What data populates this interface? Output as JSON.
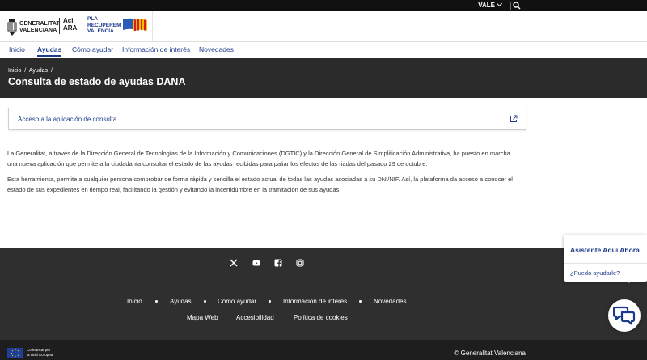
{
  "topbar": {
    "language": "VALE",
    "icons": [
      "chevron-down-icon",
      "search-icon"
    ]
  },
  "header": {
    "gva_line1": "GENERALITAT",
    "gva_line2": "VALENCIANA",
    "aci_line1": "Aci.",
    "aci_line2": "ARA.",
    "pla_line1": "PLA",
    "pla_line2": "RECUPEREM",
    "pla_line3": "VALÈNCIA"
  },
  "nav": {
    "items": [
      "Inicio",
      "Ayudas",
      "Cómo ayudar",
      "Información de interés",
      "Novedades"
    ],
    "active": "Ayudas"
  },
  "breadcrumb": {
    "items": [
      "Inicio",
      "/",
      "Ayudas",
      "/"
    ]
  },
  "page": {
    "title": "Consulta de estado de ayudas DANA"
  },
  "card": {
    "link_label": "Acceso a la aplicación de consulta",
    "icon": "external-link-icon"
  },
  "content": {
    "paragraph1": "La Generalitat, a través de la Dirección General de Tecnologías de la Información y Comunicaciones (DGTIC) y la Dirección General de Simplificación Administrativa, ha puesto en marcha una nueva aplicación que permite a la ciudadanía consultar el estado de las ayudas recibidas para paliar los efectos de las riadas del pasado 29 de octubre.",
    "paragraph2": "Esta herramienta, permite a cualquier persona comprobar de forma rápida y sencilla el estado actual de todas las ayudas asociadas a su DNI/NIF. Así, la plataforma da acceso a conocer el estado de sus expedientes en tiempo real, facilitando la gestión y evitando la incertidumbre en la tramitación de sus ayudas."
  },
  "footer": {
    "social_icons": [
      "x-icon",
      "youtube-icon",
      "facebook-icon",
      "instagram-icon"
    ],
    "links_row1": [
      "Inicio",
      "Ayudas",
      "Cómo ayudar",
      "Información de interés",
      "Novedades"
    ],
    "links_row2": [
      "Mapa Web",
      "Accesibilidad",
      "Política de cookies"
    ],
    "eu_line1": "Cofinançat per",
    "eu_line2": "la Unió Europea",
    "copyright": "© Generalitat Valenciana"
  },
  "assistant": {
    "title": "Asistente Aquí Ahora",
    "prompt": "¿Puedo ayudarle?"
  },
  "colors": {
    "brand_blue": "#1b3a8a",
    "hero_bg": "#2b2b2b",
    "footer_bg": "#2f2f2f"
  }
}
